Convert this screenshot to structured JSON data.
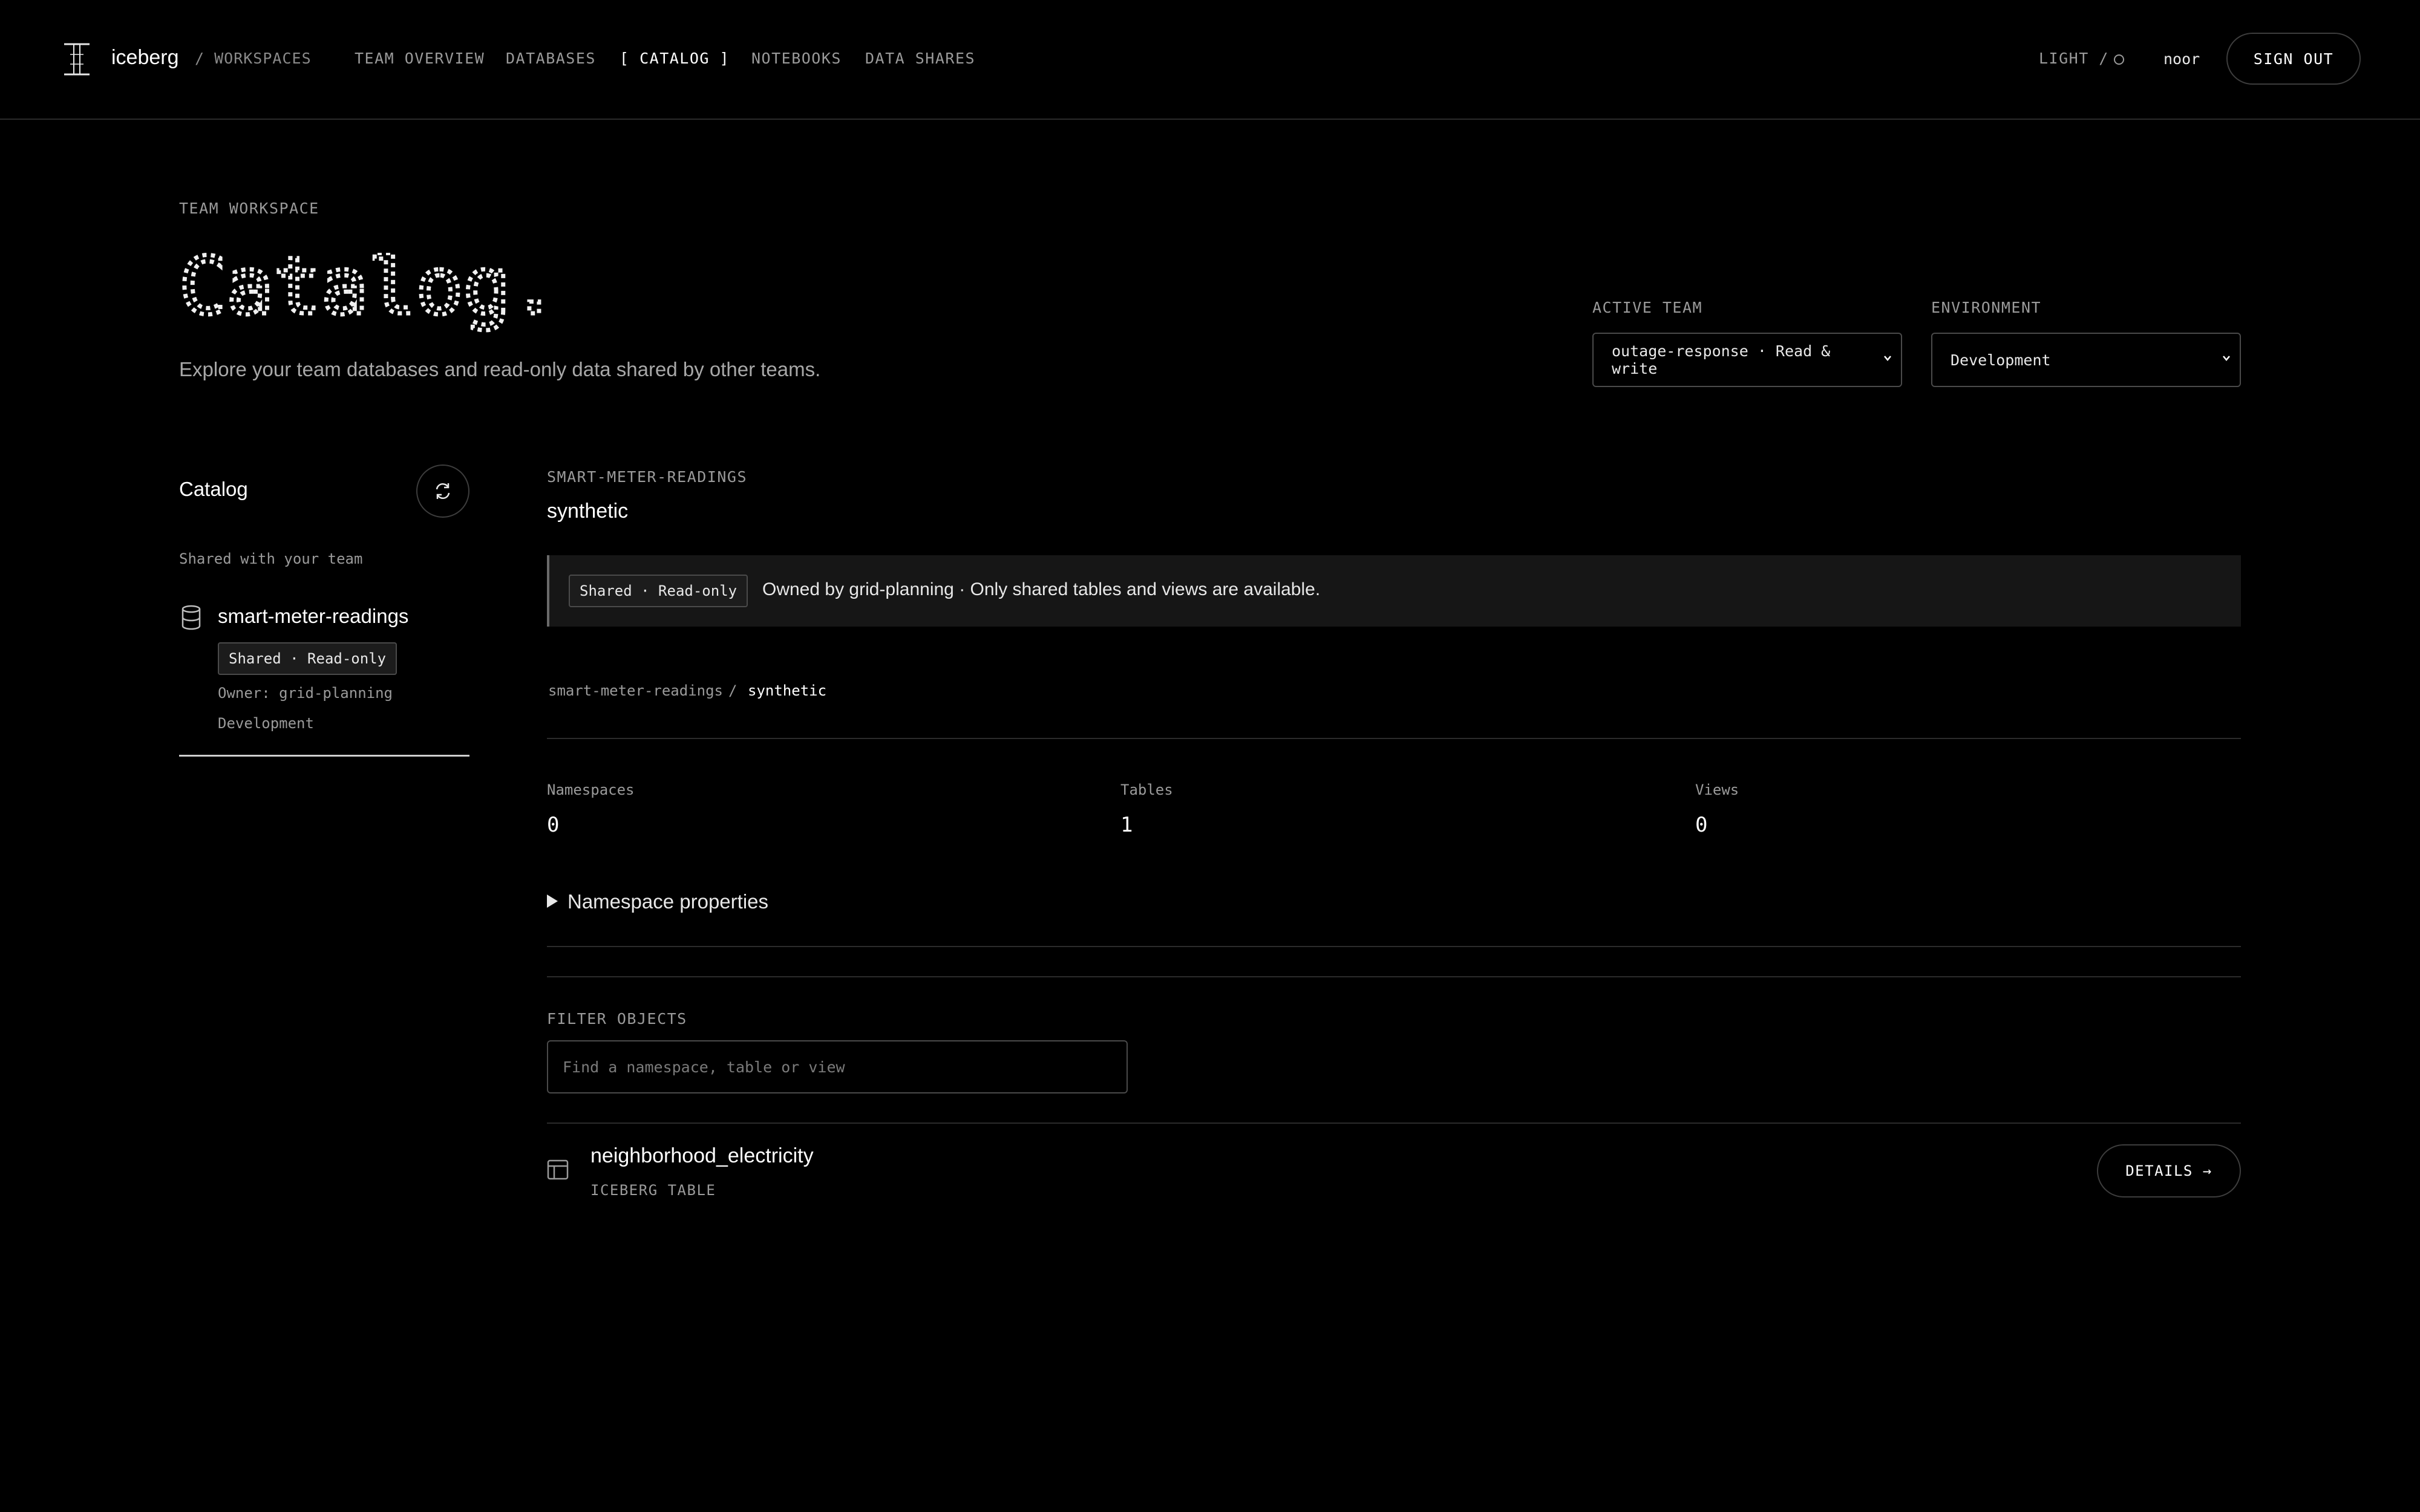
{
  "header": {
    "brand": "iceberg",
    "breadcrumb": "/ WORKSPACES",
    "nav": [
      {
        "label": "TEAM OVERVIEW"
      },
      {
        "label": "DATABASES"
      },
      {
        "label": "[ CATALOG ]"
      },
      {
        "label": "NOTEBOOKS"
      },
      {
        "label": "DATA SHARES"
      }
    ],
    "theme_toggle": "LIGHT /",
    "user": "noor",
    "sign_out": "SIGN OUT"
  },
  "page": {
    "kicker": "TEAM WORKSPACE",
    "title": "Catalog.",
    "subtitle": "Explore your team databases and read-only data shared by other teams."
  },
  "controls": {
    "active_team_label": "ACTIVE TEAM",
    "active_team_value": "outage-response · Read & write",
    "environment_label": "ENVIRONMENT",
    "environment_value": "Development"
  },
  "sidebar": {
    "title": "Catalog",
    "section": "Shared with your team",
    "database": {
      "name": "smart-meter-readings",
      "badge": "Shared · Read-only",
      "owner": "Owner: grid-planning",
      "environment": "Development"
    }
  },
  "main": {
    "kicker": "SMART-METER-READINGS",
    "namespace": "synthetic",
    "banner_badge": "Shared · Read-only",
    "banner_text": "Owned by grid-planning · Only shared tables and views are available.",
    "path_root": "smart-meter-readings",
    "path_sep": "/",
    "path_leaf": "synthetic",
    "stats": [
      {
        "label": "Namespaces",
        "value": "0"
      },
      {
        "label": "Tables",
        "value": "1"
      },
      {
        "label": "Views",
        "value": "0"
      }
    ],
    "properties_summary": "Namespace properties",
    "filter_label": "FILTER OBJECTS",
    "filter_placeholder": "Find a namespace, table or view",
    "objects": [
      {
        "name": "neighborhood_electricity",
        "type": "ICEBERG TABLE",
        "action": "DETAILS →"
      }
    ]
  },
  "colors": {
    "background": "#000000",
    "text": "#e8e8e8",
    "muted": "#9a9a9a",
    "border": "#3d3d3d"
  }
}
